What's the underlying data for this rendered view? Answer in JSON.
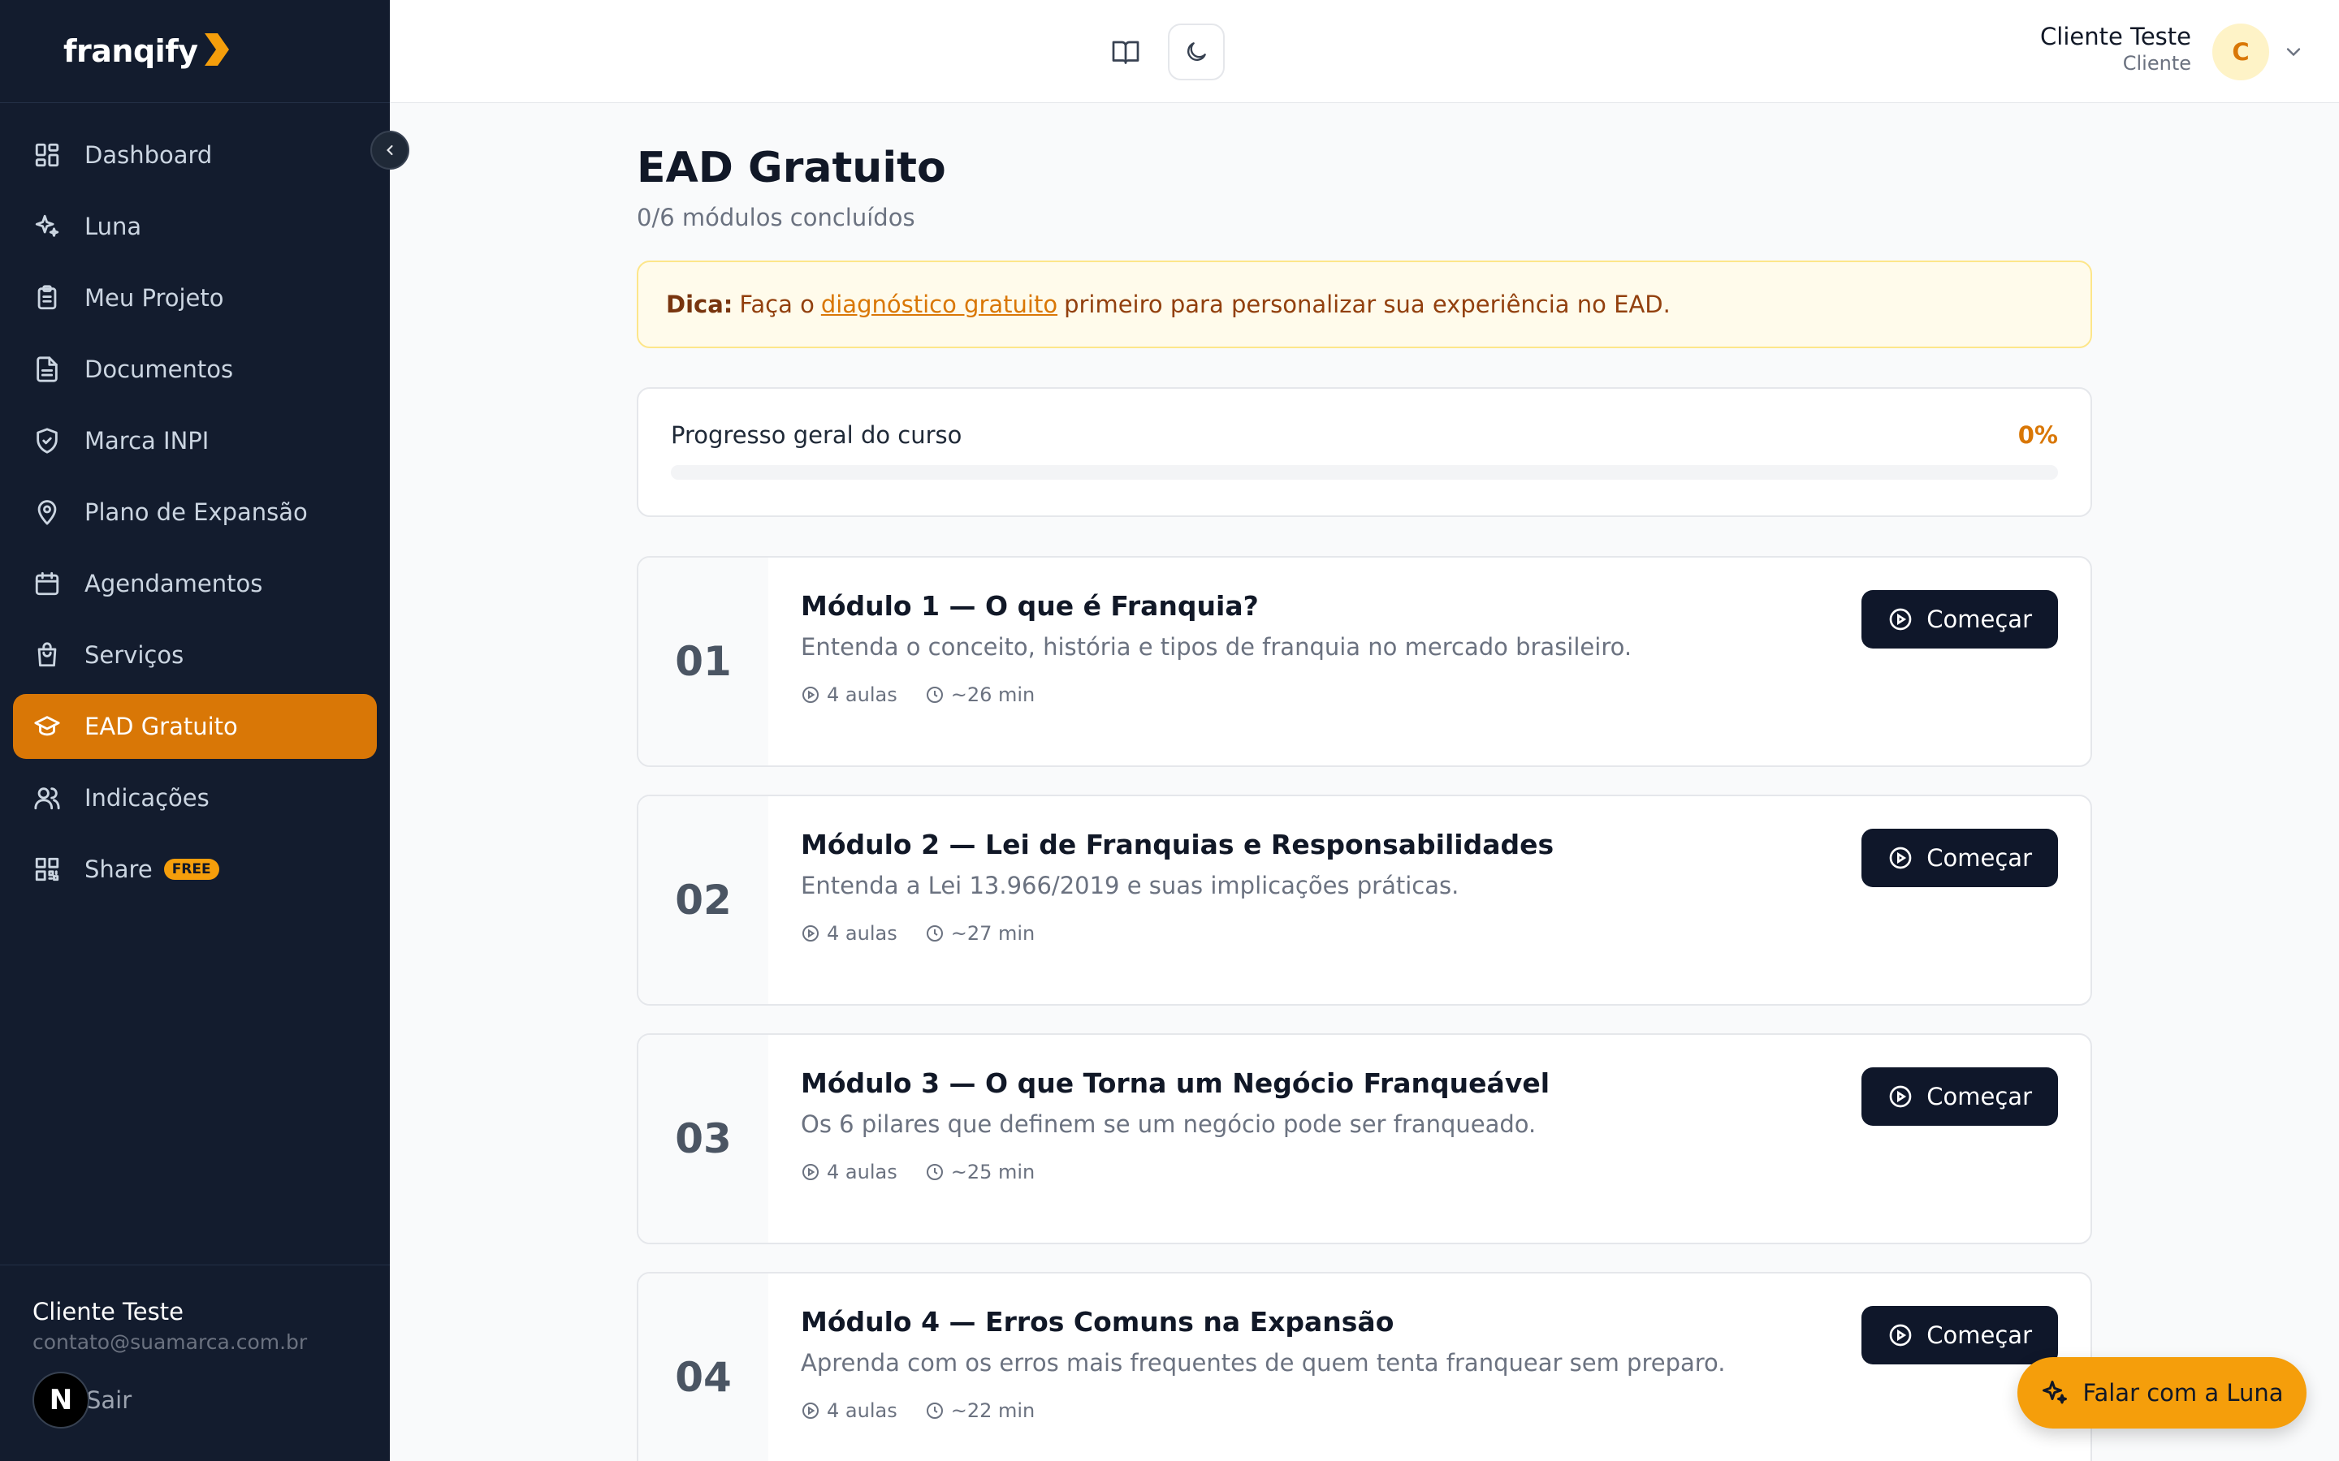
{
  "brand": {
    "name": "franqify",
    "accent": "#d97706"
  },
  "sidebar": {
    "items": [
      {
        "label": "Dashboard",
        "icon": "dashboard-icon"
      },
      {
        "label": "Luna",
        "icon": "sparkles-icon"
      },
      {
        "label": "Meu Projeto",
        "icon": "clipboard-icon"
      },
      {
        "label": "Documentos",
        "icon": "document-icon"
      },
      {
        "label": "Marca INPI",
        "icon": "shield-check-icon"
      },
      {
        "label": "Plano de Expansão",
        "icon": "map-pin-icon"
      },
      {
        "label": "Agendamentos",
        "icon": "calendar-icon"
      },
      {
        "label": "Serviços",
        "icon": "shopping-bag-icon"
      },
      {
        "label": "EAD Gratuito",
        "icon": "graduation-cap-icon",
        "active": true
      },
      {
        "label": "Indicações",
        "icon": "users-icon"
      },
      {
        "label": "Share",
        "icon": "qr-code-icon",
        "badge": "FREE"
      }
    ],
    "footer": {
      "name": "Cliente Teste",
      "email": "contato@suamarca.com.br",
      "logout_label": "Sair",
      "avatar_letter": "N"
    }
  },
  "header": {
    "user_name": "Cliente Teste",
    "user_role": "Cliente",
    "avatar_letter": "C"
  },
  "page": {
    "title": "EAD Gratuito",
    "subtitle": "0/6 módulos concluídos",
    "tip": {
      "prefix": "Dica:",
      "before": "Faça o",
      "link": "diagnóstico gratuito",
      "after": "primeiro para personalizar sua experiência no EAD."
    },
    "progress": {
      "label": "Progresso geral do curso",
      "percent_label": "0%",
      "value": 0
    }
  },
  "modules": [
    {
      "number": "01",
      "title": "Módulo 1 — O que é Franquia?",
      "description": "Entenda o conceito, história e tipos de franquia no mercado brasileiro.",
      "lessons": "4 aulas",
      "duration": "~26 min",
      "button": "Começar"
    },
    {
      "number": "02",
      "title": "Módulo 2 — Lei de Franquias e Responsabilidades",
      "description": "Entenda a Lei 13.966/2019 e suas implicações práticas.",
      "lessons": "4 aulas",
      "duration": "~27 min",
      "button": "Começar"
    },
    {
      "number": "03",
      "title": "Módulo 3 — O que Torna um Negócio Franqueável",
      "description": "Os 6 pilares que definem se um negócio pode ser franqueado.",
      "lessons": "4 aulas",
      "duration": "~25 min",
      "button": "Começar"
    },
    {
      "number": "04",
      "title": "Módulo 4 — Erros Comuns na Expansão",
      "description": "Aprenda com os erros mais frequentes de quem tenta franquear sem preparo.",
      "lessons": "4 aulas",
      "duration": "~22 min",
      "button": "Começar"
    }
  ],
  "fab": {
    "label": "Falar com a Luna",
    "icon": "sparkles-icon"
  }
}
